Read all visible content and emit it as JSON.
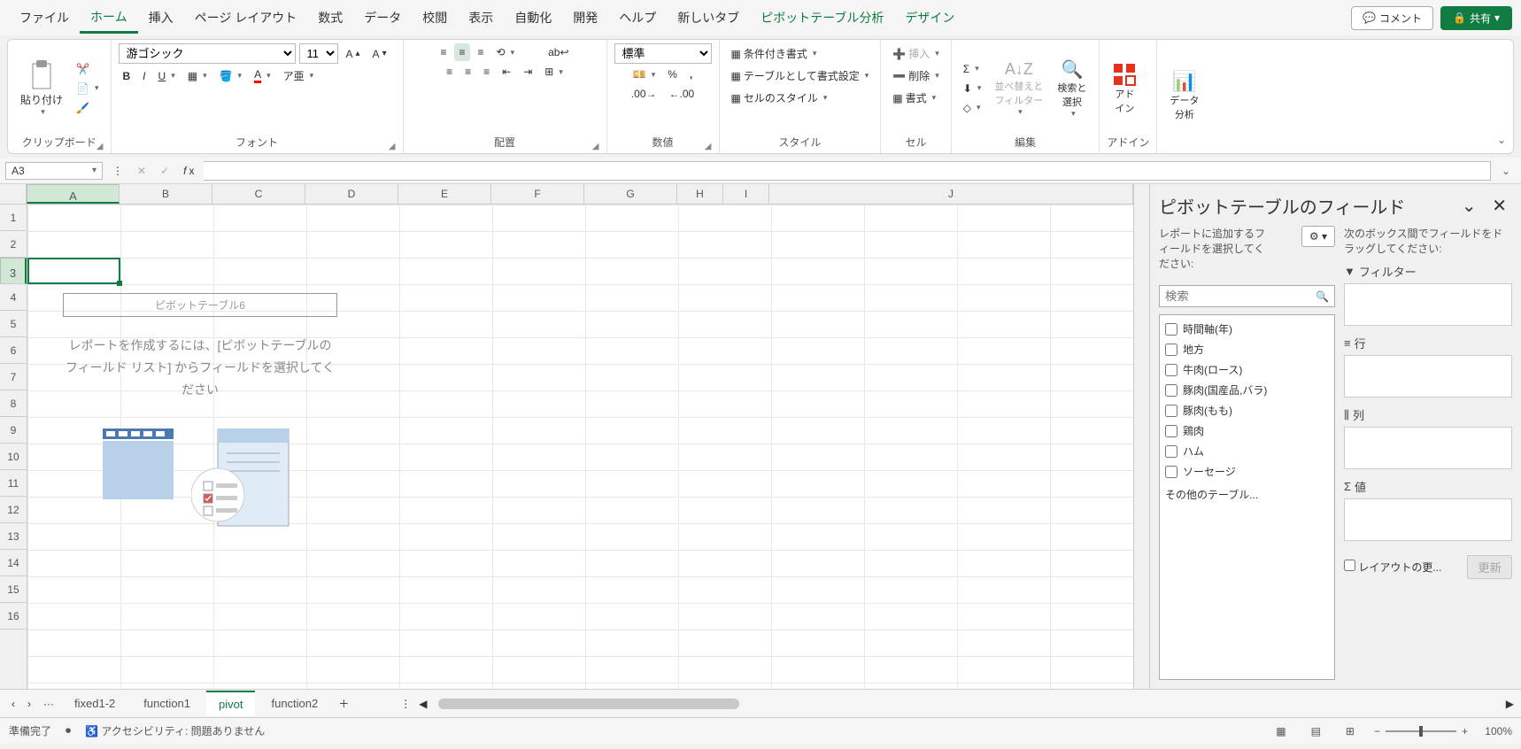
{
  "menu": {
    "items": [
      "ファイル",
      "ホーム",
      "挿入",
      "ページ レイアウト",
      "数式",
      "データ",
      "校閲",
      "表示",
      "自動化",
      "開発",
      "ヘルプ",
      "新しいタブ",
      "ピボットテーブル分析",
      "デザイン"
    ],
    "active": "ホーム",
    "comment": "コメント",
    "share": "共有"
  },
  "ribbon": {
    "clipboard": {
      "paste": "貼り付け",
      "label": "クリップボード"
    },
    "font": {
      "name": "游ゴシック",
      "size": "11",
      "label": "フォント"
    },
    "align": {
      "label": "配置"
    },
    "number": {
      "format": "標準",
      "label": "数値"
    },
    "styles": {
      "cond": "条件付き書式",
      "table": "テーブルとして書式設定",
      "cell": "セルのスタイル",
      "label": "スタイル"
    },
    "cells": {
      "insert": "挿入",
      "delete": "削除",
      "format": "書式",
      "label": "セル"
    },
    "editing": {
      "sort": "並べ替えと\nフィルター",
      "find": "検索と\n選択",
      "label": "編集"
    },
    "addins": {
      "addin": "アド\nイン",
      "label": "アドイン"
    },
    "analysis": {
      "analyze": "データ\n分析"
    }
  },
  "formula": {
    "cell_ref": "A3"
  },
  "grid": {
    "cols": [
      "A",
      "B",
      "C",
      "D",
      "E",
      "F",
      "G",
      "H",
      "I",
      "J"
    ],
    "rows": [
      "1",
      "2",
      "3",
      "4",
      "5",
      "6",
      "7",
      "8",
      "9",
      "10",
      "11",
      "12",
      "13",
      "14",
      "15",
      "16"
    ]
  },
  "pivot_placeholder": {
    "title": "ピボットテーブル6",
    "text": "レポートを作成するには、[ピボットテーブルのフィールド リスト] からフィールドを選択してください"
  },
  "pane": {
    "title": "ピボットテーブルのフィールド",
    "hint_left": "レポートに追加するフィールドを選択してください:",
    "hint_right": "次のボックス間でフィールドをドラッグしてください:",
    "search_ph": "検索",
    "fields": [
      "時間軸(年)",
      "地方",
      "牛肉(ロース)",
      "豚肉(国産品,バラ)",
      "豚肉(もも)",
      "鶏肉",
      "ハム",
      "ソーセージ"
    ],
    "other_tables": "その他のテーブル...",
    "areas": {
      "filter": "フィルター",
      "rows": "行",
      "cols": "列",
      "values": "値"
    },
    "defer": "レイアウトの更...",
    "update": "更新"
  },
  "tabs": {
    "items": [
      "fixed1-2",
      "function1",
      "pivot",
      "function2"
    ],
    "active": "pivot"
  },
  "status": {
    "ready": "準備完了",
    "access": "アクセシビリティ: 問題ありません",
    "zoom": "100%"
  }
}
